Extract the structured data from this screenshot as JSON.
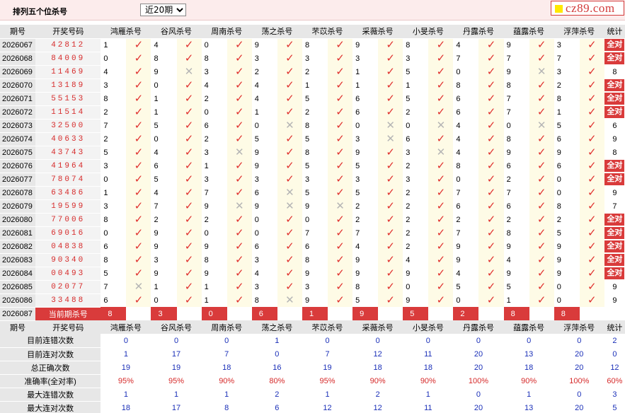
{
  "header": {
    "title": "排列五个位杀号",
    "period_selected": "近20期",
    "logo_text": "cz89.com"
  },
  "columns": [
    "期号",
    "开奖号码",
    "鸿雁杀号",
    "谷风杀号",
    "周南杀号",
    "荡之杀号",
    "芣苡杀号",
    "采薇杀号",
    "小旻杀号",
    "丹露杀号",
    "蕴露杀号",
    "浮萍杀号",
    "统计"
  ],
  "rows": [
    {
      "issue": "2026067",
      "draw": "42812",
      "kills": [
        "1",
        "4",
        "0",
        "9",
        "8",
        "9",
        "8",
        "4",
        "9",
        "3"
      ],
      "hits": [
        1,
        1,
        1,
        1,
        1,
        1,
        1,
        1,
        1,
        1
      ],
      "stat": "全对"
    },
    {
      "issue": "2026068",
      "draw": "84009",
      "kills": [
        "0",
        "8",
        "8",
        "3",
        "3",
        "3",
        "3",
        "7",
        "7",
        "7"
      ],
      "hits": [
        1,
        1,
        1,
        1,
        1,
        1,
        1,
        1,
        1,
        1
      ],
      "stat": "全对"
    },
    {
      "issue": "2026069",
      "draw": "11469",
      "kills": [
        "4",
        "9",
        "3",
        "2",
        "2",
        "1",
        "5",
        "0",
        "9",
        "3"
      ],
      "hits": [
        1,
        0,
        1,
        1,
        1,
        1,
        1,
        1,
        0,
        1
      ],
      "stat": "8"
    },
    {
      "issue": "2026070",
      "draw": "13189",
      "kills": [
        "3",
        "0",
        "4",
        "4",
        "1",
        "1",
        "1",
        "8",
        "8",
        "2"
      ],
      "hits": [
        1,
        1,
        1,
        1,
        1,
        1,
        1,
        1,
        1,
        1
      ],
      "stat": "全对"
    },
    {
      "issue": "2026071",
      "draw": "55153",
      "kills": [
        "8",
        "1",
        "2",
        "4",
        "5",
        "6",
        "5",
        "6",
        "7",
        "8"
      ],
      "hits": [
        1,
        1,
        1,
        1,
        1,
        1,
        1,
        1,
        1,
        1
      ],
      "stat": "全对"
    },
    {
      "issue": "2026072",
      "draw": "11514",
      "kills": [
        "2",
        "1",
        "0",
        "1",
        "2",
        "6",
        "2",
        "6",
        "7",
        "1"
      ],
      "hits": [
        1,
        1,
        1,
        1,
        1,
        1,
        1,
        1,
        1,
        1
      ],
      "stat": "全对"
    },
    {
      "issue": "2026073",
      "draw": "32500",
      "kills": [
        "7",
        "5",
        "6",
        "0",
        "8",
        "0",
        "0",
        "4",
        "0",
        "5"
      ],
      "hits": [
        1,
        1,
        1,
        0,
        1,
        0,
        0,
        1,
        0,
        1
      ],
      "stat": "6"
    },
    {
      "issue": "2026074",
      "draw": "40633",
      "kills": [
        "2",
        "0",
        "2",
        "5",
        "5",
        "3",
        "6",
        "4",
        "8",
        "6"
      ],
      "hits": [
        1,
        1,
        1,
        1,
        1,
        0,
        1,
        1,
        1,
        1
      ],
      "stat": "9"
    },
    {
      "issue": "2026075",
      "draw": "43743",
      "kills": [
        "5",
        "4",
        "3",
        "9",
        "8",
        "9",
        "3",
        "4",
        "9",
        "9"
      ],
      "hits": [
        1,
        1,
        0,
        1,
        1,
        1,
        0,
        1,
        1,
        1
      ],
      "stat": "8"
    },
    {
      "issue": "2026076",
      "draw": "41964",
      "kills": [
        "3",
        "6",
        "1",
        "9",
        "5",
        "5",
        "2",
        "8",
        "6",
        "6"
      ],
      "hits": [
        1,
        1,
        1,
        1,
        1,
        1,
        1,
        1,
        1,
        1
      ],
      "stat": "全对"
    },
    {
      "issue": "2026077",
      "draw": "78074",
      "kills": [
        "0",
        "5",
        "3",
        "3",
        "3",
        "3",
        "3",
        "0",
        "2",
        "0"
      ],
      "hits": [
        1,
        1,
        1,
        1,
        1,
        1,
        1,
        1,
        1,
        1
      ],
      "stat": "全对"
    },
    {
      "issue": "2026078",
      "draw": "63486",
      "kills": [
        "1",
        "4",
        "7",
        "6",
        "5",
        "5",
        "2",
        "7",
        "7",
        "0"
      ],
      "hits": [
        1,
        1,
        1,
        0,
        1,
        1,
        1,
        1,
        1,
        1
      ],
      "stat": "9"
    },
    {
      "issue": "2026079",
      "draw": "19599",
      "kills": [
        "3",
        "7",
        "9",
        "9",
        "9",
        "2",
        "2",
        "6",
        "6",
        "8"
      ],
      "hits": [
        1,
        1,
        0,
        0,
        0,
        1,
        1,
        1,
        1,
        1
      ],
      "stat": "7"
    },
    {
      "issue": "2026080",
      "draw": "77006",
      "kills": [
        "8",
        "2",
        "2",
        "0",
        "0",
        "2",
        "2",
        "2",
        "2",
        "2"
      ],
      "hits": [
        1,
        1,
        1,
        1,
        1,
        1,
        1,
        1,
        1,
        1
      ],
      "stat": "全对"
    },
    {
      "issue": "2026081",
      "draw": "69016",
      "kills": [
        "0",
        "9",
        "0",
        "0",
        "7",
        "7",
        "2",
        "7",
        "8",
        "5"
      ],
      "hits": [
        1,
        1,
        1,
        1,
        1,
        1,
        1,
        1,
        1,
        1
      ],
      "stat": "全对"
    },
    {
      "issue": "2026082",
      "draw": "04838",
      "kills": [
        "6",
        "9",
        "9",
        "6",
        "6",
        "4",
        "2",
        "9",
        "9",
        "9"
      ],
      "hits": [
        1,
        1,
        1,
        1,
        1,
        1,
        1,
        1,
        1,
        1
      ],
      "stat": "全对"
    },
    {
      "issue": "2026083",
      "draw": "90340",
      "kills": [
        "8",
        "3",
        "8",
        "3",
        "8",
        "9",
        "4",
        "9",
        "4",
        "9"
      ],
      "hits": [
        1,
        1,
        1,
        1,
        1,
        1,
        1,
        1,
        1,
        1
      ],
      "stat": "全对"
    },
    {
      "issue": "2026084",
      "draw": "00493",
      "kills": [
        "5",
        "9",
        "9",
        "4",
        "9",
        "9",
        "9",
        "4",
        "9",
        "9"
      ],
      "hits": [
        1,
        1,
        1,
        1,
        1,
        1,
        1,
        1,
        1,
        1
      ],
      "stat": "全对"
    },
    {
      "issue": "2026085",
      "draw": "02077",
      "kills": [
        "7",
        "1",
        "1",
        "3",
        "3",
        "8",
        "0",
        "5",
        "5",
        "0"
      ],
      "hits": [
        0,
        1,
        1,
        1,
        1,
        1,
        1,
        1,
        1,
        1
      ],
      "stat": "9"
    },
    {
      "issue": "2026086",
      "draw": "33488",
      "kills": [
        "6",
        "0",
        "1",
        "8",
        "9",
        "5",
        "9",
        "0",
        "1",
        "0"
      ],
      "hits": [
        1,
        1,
        1,
        0,
        1,
        1,
        1,
        1,
        1,
        1
      ],
      "stat": "9"
    }
  ],
  "current": {
    "issue": "2026087",
    "label": "当前期杀号",
    "kills": [
      "8",
      "3",
      "0",
      "6",
      "1",
      "9",
      "5",
      "2",
      "8",
      "8"
    ]
  },
  "summary": [
    {
      "label": "目前连错次数",
      "values": [
        "0",
        "0",
        "0",
        "1",
        "0",
        "0",
        "0",
        "0",
        "0",
        "0",
        "2"
      ]
    },
    {
      "label": "目前连对次数",
      "values": [
        "1",
        "17",
        "7",
        "0",
        "7",
        "12",
        "11",
        "20",
        "13",
        "20",
        "0"
      ]
    },
    {
      "label": "总正确次数",
      "values": [
        "19",
        "19",
        "18",
        "16",
        "19",
        "18",
        "18",
        "20",
        "18",
        "20",
        "12"
      ]
    },
    {
      "label": "准确率(全对率)",
      "values": [
        "95%",
        "95%",
        "90%",
        "80%",
        "95%",
        "90%",
        "90%",
        "100%",
        "90%",
        "100%",
        "60%"
      ],
      "pct": true
    },
    {
      "label": "最大连错次数",
      "values": [
        "1",
        "1",
        "1",
        "2",
        "1",
        "2",
        "1",
        "0",
        "1",
        "0",
        "3"
      ]
    },
    {
      "label": "最大连对次数",
      "values": [
        "18",
        "17",
        "8",
        "6",
        "12",
        "12",
        "11",
        "20",
        "13",
        "20",
        "5"
      ]
    }
  ],
  "glyphs": {
    "hit": "✓",
    "miss": "✕"
  },
  "colors": {
    "accent": "#d93b3b",
    "value_blue": "#1a2fb8",
    "header_bg": "#e7e7e7",
    "mark_bg": "#fefbe6"
  }
}
